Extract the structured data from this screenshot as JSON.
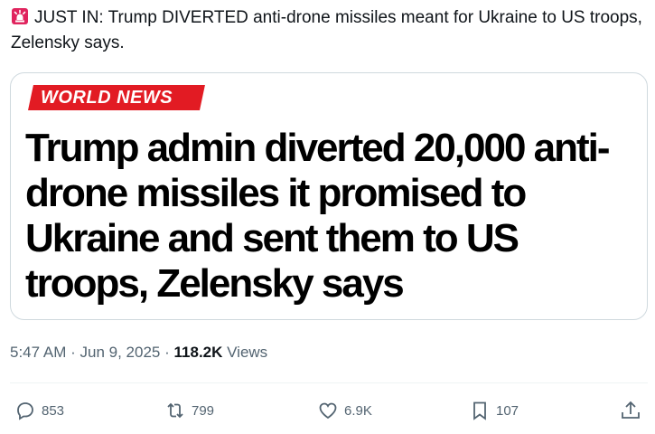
{
  "tweet": {
    "text": "JUST IN: Trump DIVERTED anti-drone missiles meant for Ukraine to US troops, Zelensky says.",
    "emoji_icon": "police-siren-icon"
  },
  "card": {
    "section_label": "WORLD NEWS",
    "headline": "Trump admin diverted 20,000 anti-drone missiles it promised to Ukraine and sent them to US troops, Zelensky says",
    "section_color": "#e21b23"
  },
  "meta": {
    "time": "5:47 AM",
    "separator": "·",
    "date": "Jun 9, 2025",
    "views_count": "118.2K",
    "views_label": "Views"
  },
  "actions": {
    "replies": "853",
    "reposts": "799",
    "likes": "6.9K",
    "bookmarks": "107"
  },
  "colors": {
    "text_primary": "#0f1419",
    "text_secondary": "#536471",
    "border": "#cfd9de"
  }
}
